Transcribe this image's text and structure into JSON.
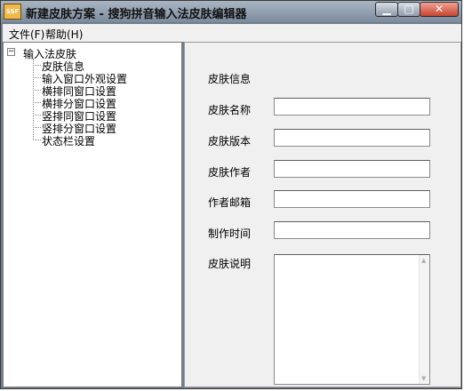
{
  "window": {
    "title": "新建皮肤方案 - 搜狗拼音输入法皮肤编辑器",
    "icon_text": "SSF",
    "icon_name": "ssf-app-icon"
  },
  "menu": {
    "file": "文件(F)",
    "help": "帮助(H)"
  },
  "tree": {
    "root": "输入法皮肤",
    "items": [
      "皮肤信息",
      "输入窗口外观设置",
      "横排同窗口设置",
      "横排分窗口设置",
      "竖排同窗口设置",
      "竖排分窗口设置",
      "状态栏设置"
    ]
  },
  "panel": {
    "heading": "皮肤信息",
    "fields": {
      "name": {
        "label": "皮肤名称",
        "value": ""
      },
      "version": {
        "label": "皮肤版本",
        "value": ""
      },
      "author": {
        "label": "皮肤作者",
        "value": ""
      },
      "email": {
        "label": "作者邮箱",
        "value": ""
      },
      "date": {
        "label": "制作时间",
        "value": ""
      },
      "description": {
        "label": "皮肤说明",
        "value": ""
      }
    }
  },
  "colors": {
    "titlebar": "#8a99aa",
    "close_button": "#c7442e",
    "panel_bg": "#f0f0f0"
  }
}
